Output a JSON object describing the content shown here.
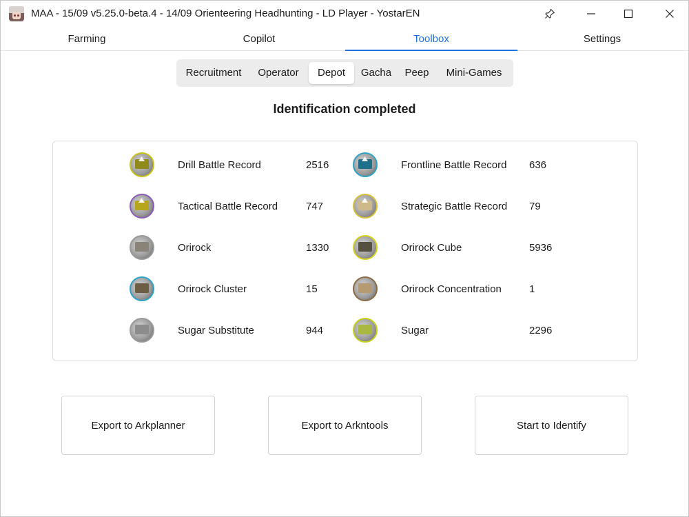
{
  "window": {
    "title": "MAA - 15/09 v5.25.0-beta.4 - 14/09 Orienteering Headhunting - LD Player - YostarEN"
  },
  "nav": {
    "tabs": [
      {
        "label": "Farming"
      },
      {
        "label": "Copilot"
      },
      {
        "label": "Toolbox"
      },
      {
        "label": "Settings"
      }
    ],
    "active": "Toolbox"
  },
  "subtabs": {
    "items": [
      {
        "label": "Recruitment"
      },
      {
        "label": "Operator"
      },
      {
        "label": "Depot"
      },
      {
        "label": "Gacha"
      },
      {
        "label": "Peep"
      },
      {
        "label": "Mini-Games"
      }
    ],
    "active": "Depot"
  },
  "depot": {
    "status": "Identification completed",
    "items": [
      {
        "name": "Drill Battle Record",
        "count": "2516",
        "icon": "drill-battle-record-icon",
        "ring": "#c9c21a",
        "fill": "#8f8a1a"
      },
      {
        "name": "Frontline Battle Record",
        "count": "636",
        "icon": "frontline-battle-record-icon",
        "ring": "#2ba3c9",
        "fill": "#1d6f8a"
      },
      {
        "name": "Tactical Battle Record",
        "count": "747",
        "icon": "tactical-battle-record-icon",
        "ring": "#8c5bb8",
        "fill": "#b5a61e"
      },
      {
        "name": "Strategic Battle Record",
        "count": "79",
        "icon": "strategic-battle-record-icon",
        "ring": "#d9c23a",
        "fill": "#cdb98a"
      },
      {
        "name": "Orirock",
        "count": "1330",
        "icon": "orirock-icon",
        "ring": "#9a9a9a",
        "fill": "#8a8478"
      },
      {
        "name": "Orirock Cube",
        "count": "5936",
        "icon": "orirock-cube-icon",
        "ring": "#d8d21e",
        "fill": "#55503f"
      },
      {
        "name": "Orirock Cluster",
        "count": "15",
        "icon": "orirock-cluster-icon",
        "ring": "#2ba3c9",
        "fill": "#6b5e44"
      },
      {
        "name": "Orirock Concentration",
        "count": "1",
        "icon": "orirock-concentration-icon",
        "ring": "#8c6a45",
        "fill": "#b59a72"
      },
      {
        "name": "Sugar Substitute",
        "count": "944",
        "icon": "sugar-substitute-icon",
        "ring": "#9a9a9a",
        "fill": "#8c8c8c"
      },
      {
        "name": "Sugar",
        "count": "2296",
        "icon": "sugar-icon",
        "ring": "#c9d21a",
        "fill": "#a8b840"
      }
    ]
  },
  "actions": {
    "export_arkplanner": "Export to Arkplanner",
    "export_arkntools": "Export to Arkntools",
    "start_identify": "Start to Identify"
  }
}
